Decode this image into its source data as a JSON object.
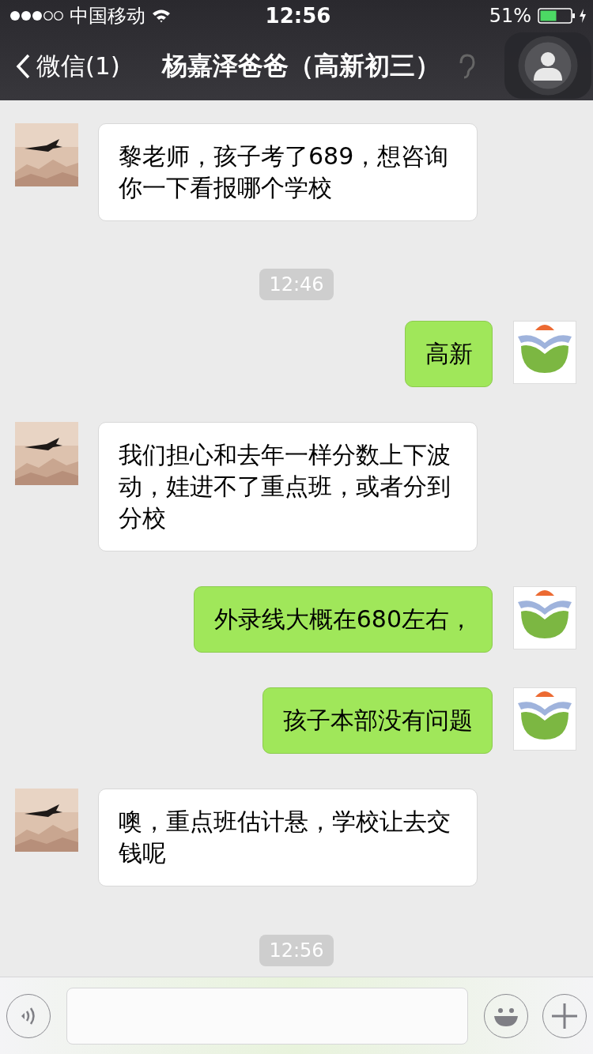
{
  "status_bar": {
    "carrier": "中国移动",
    "time": "12:56",
    "battery": "51%"
  },
  "nav": {
    "back_label": "微信(1)",
    "title": "杨嘉泽爸爸（高新初三）"
  },
  "messages": [
    {
      "kind": "incoming",
      "text": "黎老师，孩子考了689，想咨询你一下看报哪个学校"
    },
    {
      "kind": "time",
      "text": "12:46"
    },
    {
      "kind": "outgoing",
      "text": "高新"
    },
    {
      "kind": "incoming",
      "text": "我们担心和去年一样分数上下波动，娃进不了重点班，或者分到分校"
    },
    {
      "kind": "outgoing",
      "text": "外录线大概在680左右，"
    },
    {
      "kind": "outgoing",
      "text": "孩子本部没有问题"
    },
    {
      "kind": "incoming",
      "text": "噢，重点班估计悬，学校让去交钱呢"
    },
    {
      "kind": "time",
      "text": "12:56"
    }
  ]
}
